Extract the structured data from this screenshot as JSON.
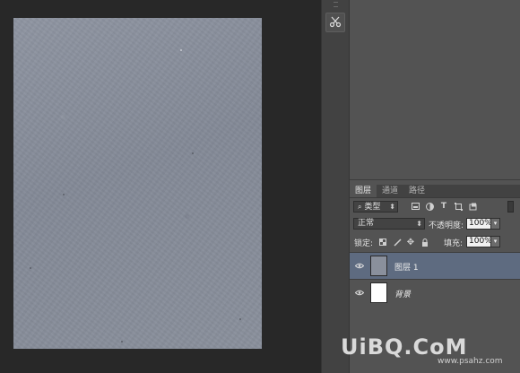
{
  "toolstrip": {
    "tool_icon": "scissors-icon"
  },
  "layers_panel": {
    "tabs": [
      {
        "label": "图层",
        "active": true
      },
      {
        "label": "通道",
        "active": false
      },
      {
        "label": "路径",
        "active": false
      }
    ],
    "filter": {
      "label": "类型",
      "icons": [
        "image-filter-icon",
        "adjustment-filter-icon",
        "text-filter-icon",
        "shape-filter-icon",
        "smart-object-filter-icon"
      ]
    },
    "blend_mode": "正常",
    "opacity": {
      "label": "不透明度:",
      "value": "100%"
    },
    "lock": {
      "label": "锁定:",
      "icons": [
        "lock-transparent-icon",
        "lock-brush-icon",
        "lock-move-icon",
        "lock-all-icon"
      ]
    },
    "fill": {
      "label": "填充:",
      "value": "100%"
    },
    "layers": [
      {
        "name": "图层 1",
        "selected": true,
        "thumb_color": "#8a909c"
      },
      {
        "name": "背景",
        "selected": false,
        "thumb_color": "#ffffff"
      }
    ]
  },
  "watermark": {
    "main": "UiBQ.CoM",
    "sub": "www.psahz.com"
  },
  "colors": {
    "selected_layer": "#5e6b80",
    "panel": "#535353",
    "document": "#8a909c"
  }
}
